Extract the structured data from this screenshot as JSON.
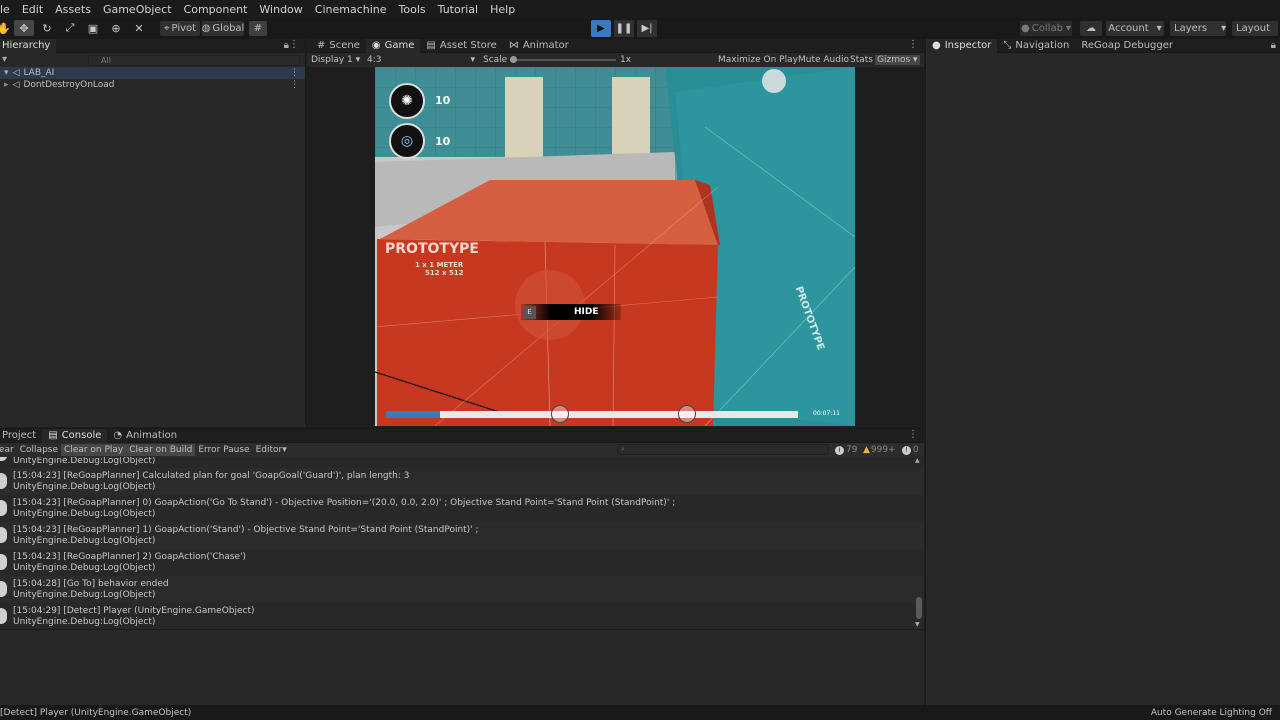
{
  "menubar": [
    "le",
    "Edit",
    "Assets",
    "GameObject",
    "Component",
    "Window",
    "Cinemachine",
    "Tools",
    "Tutorial",
    "Help"
  ],
  "toolbar": {
    "pivot_label": "Pivot",
    "global_label": "Global",
    "collab_label": "Collab",
    "account_label": "Account",
    "layers_label": "Layers",
    "layout_label": "Layout"
  },
  "hierarchy": {
    "tab": "Hierarchy",
    "search_placeholder": "All",
    "items": [
      "LAB_AI",
      "DontDestroyOnLoad"
    ]
  },
  "center": {
    "tabs": [
      "Scene",
      "Game",
      "Asset Store",
      "Animator"
    ],
    "display": "Display 1",
    "aspect": "4:3",
    "scale_label": "Scale",
    "scale_value": "1x",
    "maximize": "Maximize On Play",
    "mute": "Mute Audio",
    "stats": "Stats",
    "gizmos": "Gizmos"
  },
  "game": {
    "counter1": "10",
    "counter2": "10",
    "box_title": "PROTOTYPE",
    "box_sub1": "1 x 1 METER",
    "box_sub2": "512 x 512",
    "wall_title": "PROTOTYPE",
    "prompt_key": "E",
    "prompt_text": "HIDE",
    "timer": "00:07:11",
    "progress_fraction": 0.13
  },
  "inspector": {
    "tabs": [
      "Inspector",
      "Navigation",
      "ReGoap Debugger"
    ]
  },
  "console": {
    "tabs": [
      "Project",
      "Console",
      "Animation"
    ],
    "buttons": [
      "ear",
      "Collapse",
      "Clear on Play",
      "Clear on Build",
      "Error Pause",
      "Editor"
    ],
    "count_info": "79",
    "count_warn": "999+",
    "count_err": "0",
    "top_partial": "UnityEngine.Debug:Log(Object)",
    "logs": [
      {
        "line1": "[15:04:23] [ReGoapPlanner] Calculated plan for goal 'GoapGoal('Guard')', plan length: 3",
        "line2": "UnityEngine.Debug:Log(Object)"
      },
      {
        "line1": "[15:04:23] [ReGoapPlanner] 0) GoapAction('Go To Stand') - Objective Position='(20.0, 0.0, 2.0)' ; Objective Stand Point='Stand Point (StandPoint)' ;",
        "line2": "UnityEngine.Debug:Log(Object)"
      },
      {
        "line1": "[15:04:23] [ReGoapPlanner] 1) GoapAction('Stand') - Objective Stand Point='Stand Point (StandPoint)' ;",
        "line2": "UnityEngine.Debug:Log(Object)"
      },
      {
        "line1": "[15:04:23] [ReGoapPlanner] 2) GoapAction('Chase')",
        "line2": "UnityEngine.Debug:Log(Object)"
      },
      {
        "line1": "[15:04:28] [Go To] behavior ended",
        "line2": "UnityEngine.Debug:Log(Object)"
      },
      {
        "line1": "[15:04:29] [Detect] Player (UnityEngine.GameObject)",
        "line2": "UnityEngine.Debug:Log(Object)"
      }
    ]
  },
  "status": {
    "left": "[Detect] Player (UnityEngine.GameObject)",
    "right": "Auto Generate Lighting Off"
  },
  "colors": {
    "accent_blue": "#3a79bb",
    "box_red": "#c6381f",
    "wall_teal": "#2a8e97"
  }
}
